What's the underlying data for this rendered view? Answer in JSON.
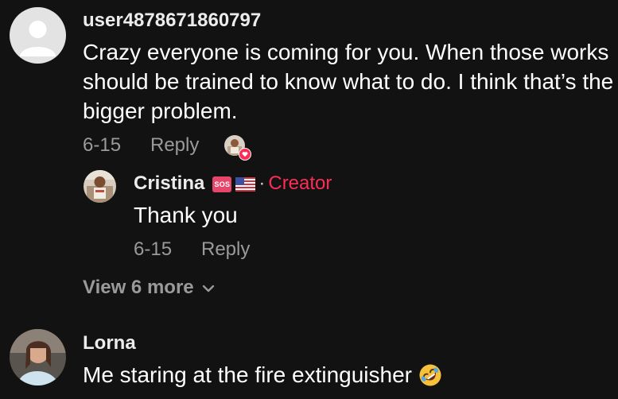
{
  "comments": [
    {
      "username": "user4878671860797",
      "text": "Crazy everyone is coming for you. When those works should be trained to know what to do. I think that’s the bigger problem.",
      "date": "6-15",
      "reply_label": "Reply",
      "avatar": "default-user-avatar",
      "liked_by_creator": true,
      "replies": [
        {
          "username": "Cristina",
          "badges": [
            "sos-badge",
            "us-flag"
          ],
          "separator": "·",
          "creator_label": "Creator",
          "text": "Thank you",
          "date": "6-15",
          "reply_label": "Reply"
        }
      ],
      "view_more_label": "View 6 more"
    },
    {
      "username": "Lorna",
      "text": "Me staring at the fire extinguisher",
      "emoji": "rolling-on-floor-laughing-emoji"
    }
  ],
  "colors": {
    "background": "#121212",
    "creator_accent": "#fe2c55",
    "secondary_text": "#9a9a9a"
  }
}
